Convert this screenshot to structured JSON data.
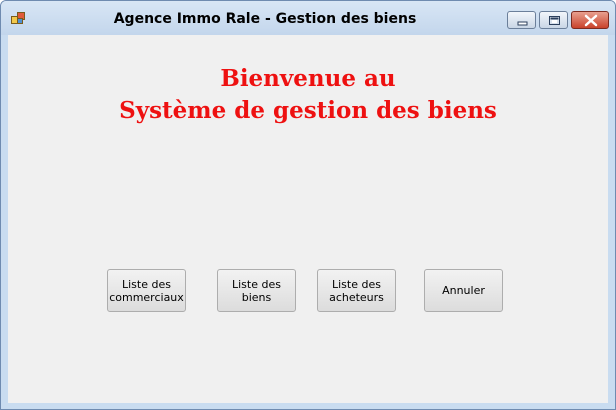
{
  "window": {
    "title": "Agence Immo Rale - Gestion des biens",
    "controls": {
      "minimize_icon": "minimize-icon",
      "maximize_icon": "maximize-icon",
      "close_icon": "close-icon"
    }
  },
  "main": {
    "heading_line1": "Bienvenue au",
    "heading_line2": "Système de gestion des biens",
    "heading_color": "#ee1111",
    "buttons": [
      {
        "label": "Liste des\ncommerciaux"
      },
      {
        "label": "Liste des\nbiens"
      },
      {
        "label": "Liste des\nacheteurs"
      },
      {
        "label": "Annuler"
      }
    ]
  }
}
